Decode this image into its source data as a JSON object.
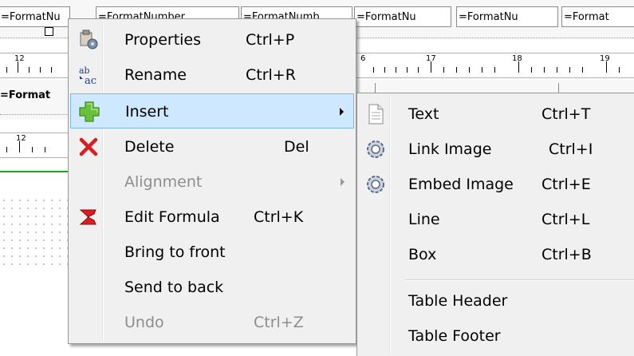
{
  "header_cells": [
    {
      "text": "=FormatNu"
    },
    {
      "text": "=FormatNumber"
    },
    {
      "text": "=FormatNumb"
    },
    {
      "text": "=FormatNu"
    },
    {
      "text": "=FormatNu"
    },
    {
      "text": "=Format"
    }
  ],
  "ruler_top": {
    "labels": [
      "12",
      "6",
      "17",
      "18",
      "19"
    ]
  },
  "section_label": "=Format",
  "ruler_second": {
    "labels": [
      "12"
    ]
  },
  "context_menu": {
    "items": [
      {
        "label": "Properties",
        "shortcut": "Ctrl+P",
        "icon": "properties-icon",
        "disabled": false
      },
      {
        "label": "Rename",
        "shortcut": "Ctrl+R",
        "icon": "rename-icon",
        "disabled": false
      },
      {
        "label": "Insert",
        "shortcut": "",
        "icon": "insert-plus-icon",
        "disabled": false,
        "submenu": true,
        "highlighted": true
      },
      {
        "label": "Delete",
        "shortcut": "Del",
        "icon": "delete-x-icon",
        "disabled": false
      },
      {
        "label": "Alignment",
        "shortcut": "",
        "icon": "",
        "disabled": true,
        "submenu": true
      },
      {
        "label": "Edit Formula",
        "shortcut": "Ctrl+K",
        "icon": "formula-sigma-icon",
        "disabled": false
      },
      {
        "label": "Bring to front",
        "shortcut": "",
        "icon": "",
        "disabled": false
      },
      {
        "label": "Send to back",
        "shortcut": "",
        "icon": "",
        "disabled": false
      },
      {
        "label": "Undo",
        "shortcut": "Ctrl+Z",
        "icon": "",
        "disabled": true
      }
    ]
  },
  "insert_submenu": {
    "items": [
      {
        "label": "Text",
        "shortcut": "Ctrl+T",
        "icon": "text-document-icon"
      },
      {
        "label": "Link Image",
        "shortcut": "Ctrl+I",
        "icon": "image-gear-icon"
      },
      {
        "label": "Embed Image",
        "shortcut": "Ctrl+E",
        "icon": "image-gear-icon"
      },
      {
        "label": "Line",
        "shortcut": "Ctrl+L",
        "icon": ""
      },
      {
        "label": "Box",
        "shortcut": "Ctrl+B",
        "icon": ""
      },
      {
        "label": "Table Header",
        "shortcut": "",
        "icon": ""
      },
      {
        "label": "Table Footer",
        "shortcut": "",
        "icon": ""
      }
    ]
  },
  "colors": {
    "highlight": "#cde8ff",
    "highlight_border": "#7fb8e8",
    "menu_bg": "#f0f0f0",
    "disabled_text": "#8d8d8d"
  }
}
